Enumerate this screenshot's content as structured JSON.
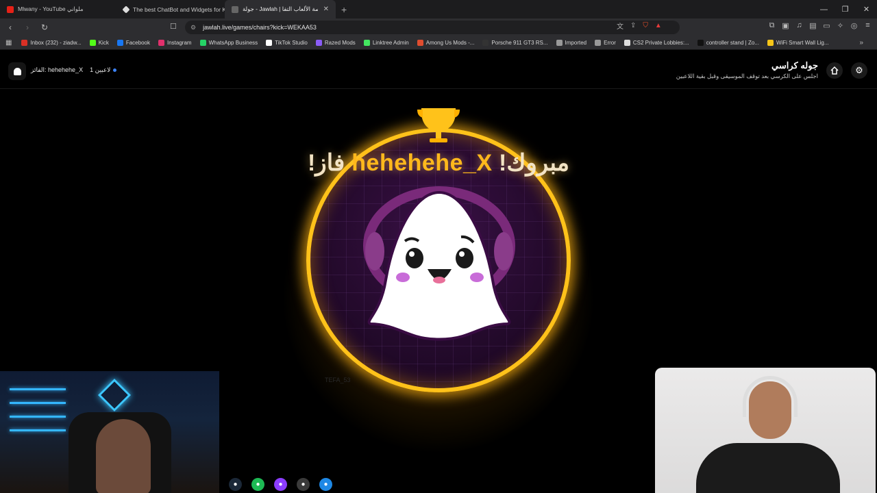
{
  "browser": {
    "tabs": [
      {
        "title": "Mlwany - YouTube ملواني",
        "color": "#e62117",
        "active": false
      },
      {
        "title": "The best ChatBot and Widgets for Ki",
        "color": "#dddddd",
        "active": false
      },
      {
        "title": "جولة - Jawlah | منصة الألعاب التفا",
        "color": "#666666",
        "active": true
      }
    ],
    "new_tab_icon": "plus-icon",
    "url": "jawlah.live/games/chairs?kick=WEKAA53",
    "bookmarks": [
      {
        "label": "Inbox (232) - ziadw...",
        "color": "#d93025"
      },
      {
        "label": "Kick",
        "color": "#53fc18"
      },
      {
        "label": "Facebook",
        "color": "#1877f2"
      },
      {
        "label": "Instagram",
        "color": "#e1306c"
      },
      {
        "label": "WhatsApp Business",
        "color": "#25d366"
      },
      {
        "label": "TikTok Studio",
        "color": "#ffffff"
      },
      {
        "label": "Razed Mods",
        "color": "#8a5cf6"
      },
      {
        "label": "Linktree Admin",
        "color": "#43e660"
      },
      {
        "label": "Among Us Mods -...",
        "color": "#e04d2f"
      },
      {
        "label": "Porsche 911 GT3 RS...",
        "color": "#333333"
      },
      {
        "label": "Imported",
        "color": "#999999"
      },
      {
        "label": "Error",
        "color": "#999999"
      },
      {
        "label": "CS2 Private Lobbies:...",
        "color": "#dddddd"
      },
      {
        "label": "controller stand | Zo...",
        "color": "#111111"
      },
      {
        "label": "WiFi Smart Wall Lig...",
        "color": "#f5c518"
      }
    ]
  },
  "header": {
    "winner_label": "الفائز: hehehehe_X",
    "players_count": "1 لاعبين",
    "game_title": "جوله كراسي",
    "game_subtitle": "اجلس على الكرسي بعد توقف الموسيقى وقبل بقية اللاعبين",
    "home_icon": "home-icon",
    "settings_icon": "gear-icon"
  },
  "winner": {
    "prefix": "مبروك! ",
    "name": "hehehehe_X",
    "suffix": " فاز!",
    "faded_player": "TEFA_53",
    "ring_color": "#ffc21a"
  },
  "taskbar": {
    "icons": [
      {
        "name": "steam-icon",
        "color": "#1b2838"
      },
      {
        "name": "spotify-icon",
        "color": "#1db954"
      },
      {
        "name": "messenger-icon",
        "color": "#8b3dff"
      },
      {
        "name": "obs-icon",
        "color": "#3a3a3a"
      },
      {
        "name": "browser-icon",
        "color": "#1e88e5"
      }
    ]
  }
}
